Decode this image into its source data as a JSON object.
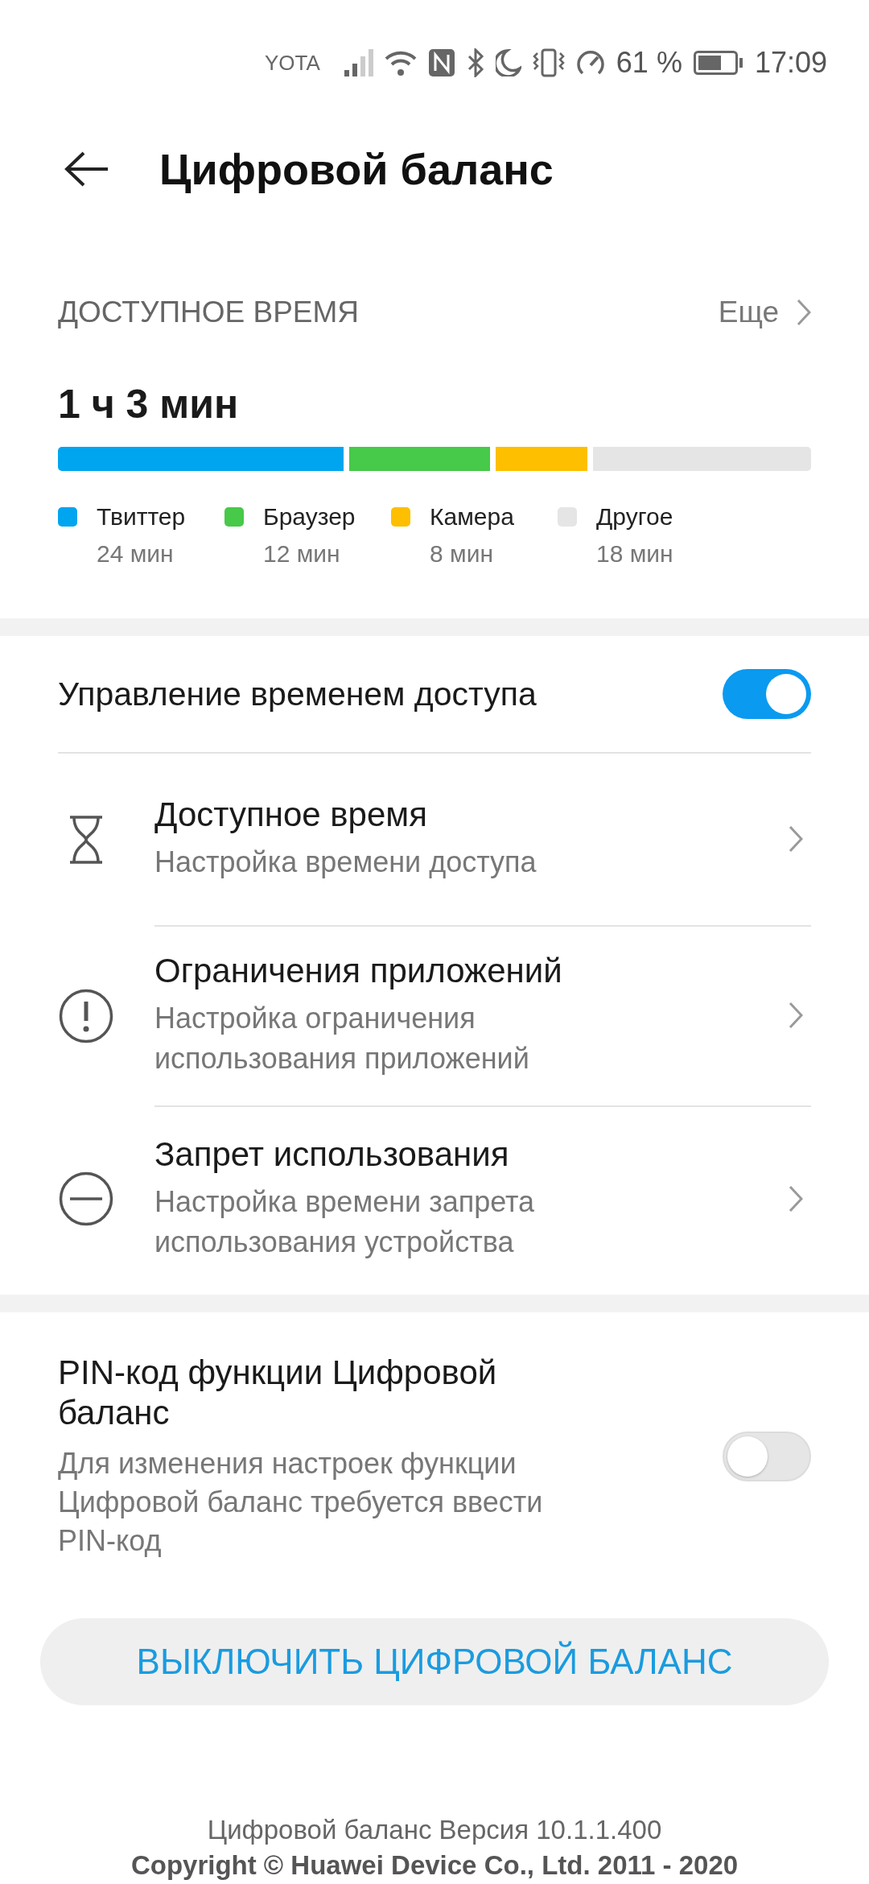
{
  "status_bar": {
    "carrier": "YOTA",
    "battery_percent": "61 %",
    "time": "17:09"
  },
  "header": {
    "title": "Цифровой баланс"
  },
  "usage": {
    "heading": "ДОСТУПНОЕ ВРЕМЯ",
    "more": "Еще",
    "total": "1 ч 3 мин",
    "apps": [
      {
        "name": "Твиттер",
        "time": "24 мин",
        "color": "#00a5ef"
      },
      {
        "name": "Браузер",
        "time": "12 мин",
        "color": "#47c94a"
      },
      {
        "name": "Камера",
        "time": "8 мин",
        "color": "#fdbf00"
      },
      {
        "name": "Другое",
        "time": "18 мин",
        "color": "#e5e5e5"
      }
    ]
  },
  "access_control": {
    "label": "Управление временем доступа",
    "on": true
  },
  "settings": [
    {
      "kind": "hourglass",
      "title": "Доступное время",
      "subtitle": "Настройка времени доступа"
    },
    {
      "kind": "alert",
      "title": "Ограничения приложений",
      "subtitle": "Настройка ограничения использования приложений"
    },
    {
      "kind": "block",
      "title": "Запрет использования",
      "subtitle": "Настройка времени запрета использования устройства"
    }
  ],
  "pin": {
    "title": "PIN-код функции Цифровой баланс",
    "description": "Для изменения настроек функции Цифровой баланс требуется ввести PIN-код",
    "on": false
  },
  "disable_button": "ВЫКЛЮЧИТЬ ЦИФРОВОЙ БАЛАНС",
  "footer": {
    "version": "Цифровой баланс Версия 10.1.1.400",
    "copyright": "Copyright © Huawei Device Co., Ltd. 2011 - 2020"
  }
}
